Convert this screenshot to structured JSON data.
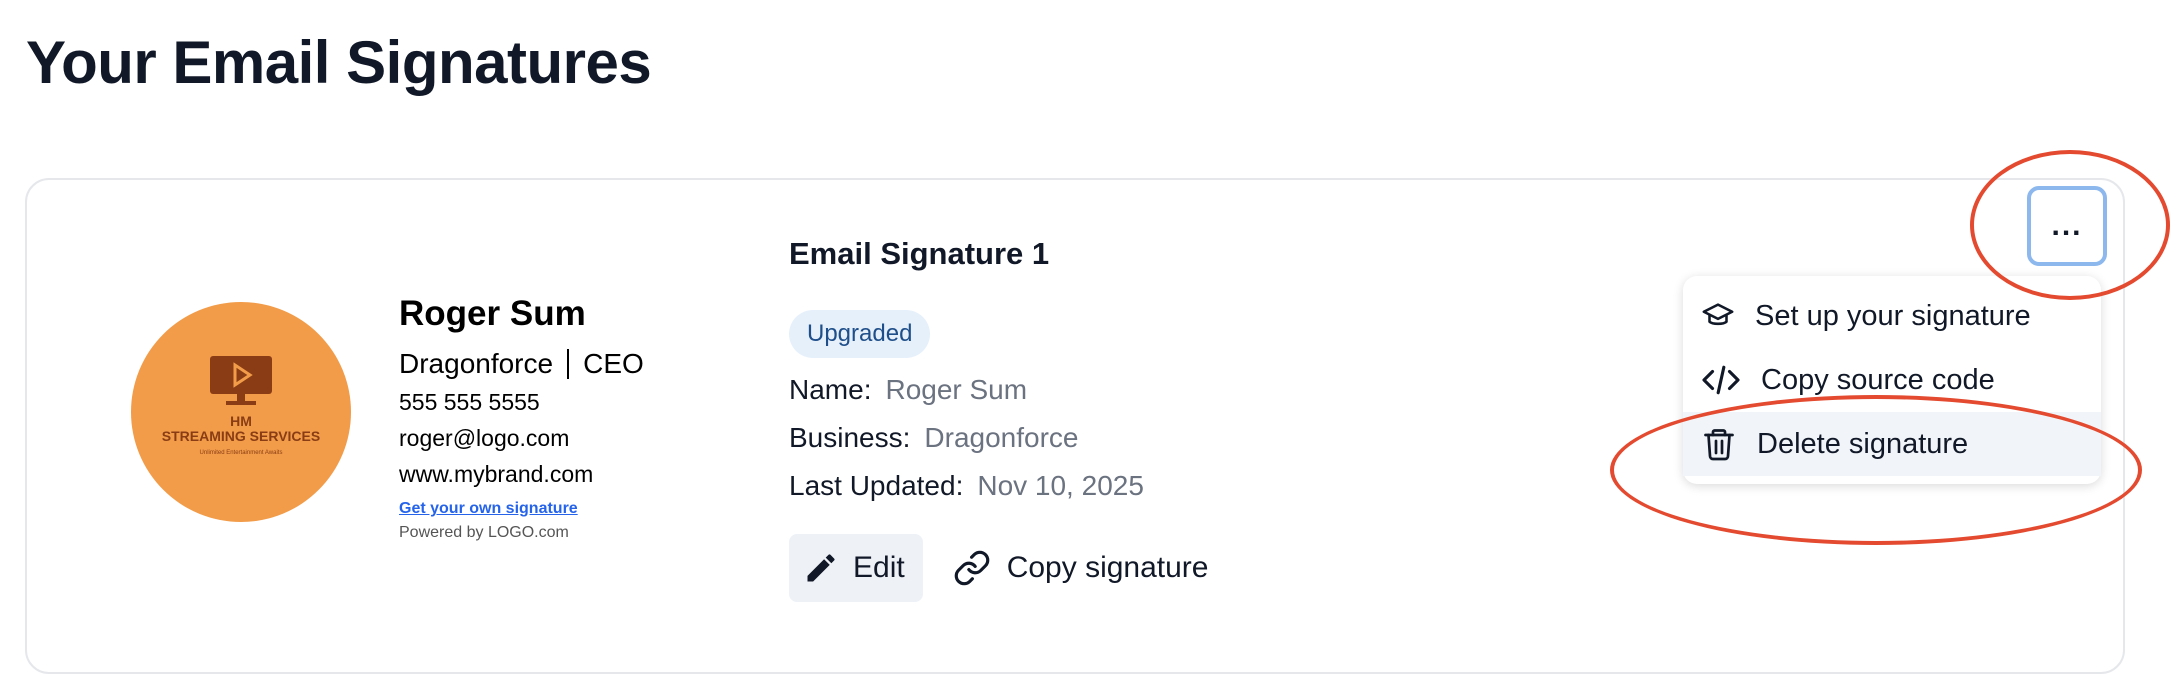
{
  "page": {
    "title": "Your Email Signatures"
  },
  "preview": {
    "logo": {
      "line1": "HM",
      "line2": "STREAMING SERVICES",
      "tagline": "Unlimited Entertainment Awaits",
      "color": "#f29c4a"
    },
    "name": "Roger Sum",
    "company": "Dragonforce",
    "role": "CEO",
    "phone": "555 555 5555",
    "email": "roger@logo.com",
    "website": "www.mybrand.com",
    "cta_link": "Get your own signature",
    "powered": "Powered by LOGO.com"
  },
  "details": {
    "title": "Email Signature 1",
    "badge": "Upgraded",
    "name_label": "Name:",
    "name_value": "Roger Sum",
    "business_label": "Business:",
    "business_value": "Dragonforce",
    "updated_label": "Last Updated:",
    "updated_value": "Nov 10, 2025",
    "edit_label": "Edit",
    "copy_label": "Copy signature"
  },
  "more_button": {
    "label": "..."
  },
  "menu": {
    "items": [
      {
        "label": "Set up your signature",
        "icon": "graduation-cap-icon"
      },
      {
        "label": "Copy source code",
        "icon": "code-icon"
      },
      {
        "label": "Delete signature",
        "icon": "trash-icon"
      }
    ]
  },
  "colors": {
    "annotation": "#e34a2f",
    "badge_bg": "#e6f0fb",
    "accent": "#2563eb"
  }
}
